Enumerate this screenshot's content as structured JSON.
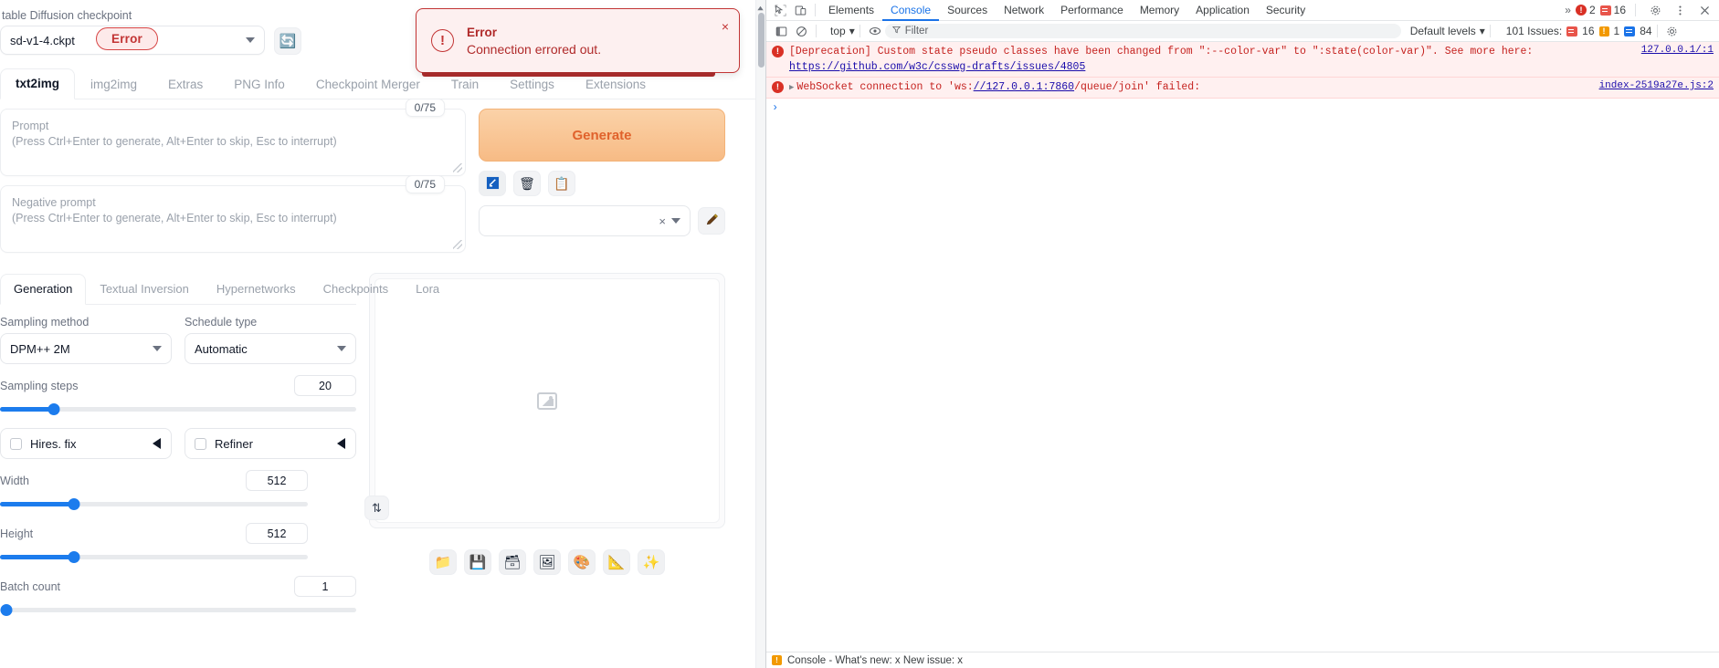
{
  "webui": {
    "checkpoint": {
      "label": "table Diffusion checkpoint",
      "value": "sd-v1-4.ckpt",
      "refresh_icon": "refresh-icon",
      "error_badge": "Error"
    },
    "top_tabs": [
      {
        "label": "txt2img",
        "active": true
      },
      {
        "label": "img2img",
        "active": false
      },
      {
        "label": "Extras",
        "active": false
      },
      {
        "label": "PNG Info",
        "active": false
      },
      {
        "label": "Checkpoint Merger",
        "active": false
      },
      {
        "label": "Train",
        "active": false
      },
      {
        "label": "Settings",
        "active": false
      },
      {
        "label": "Extensions",
        "active": false
      }
    ],
    "prompt": {
      "title": "Prompt",
      "hint": "(Press Ctrl+Enter to generate, Alt+Enter to skip, Esc to interrupt)",
      "token_count": "0/75",
      "value": ""
    },
    "negative_prompt": {
      "title": "Negative prompt",
      "hint": "(Press Ctrl+Enter to generate, Alt+Enter to skip, Esc to interrupt)",
      "token_count": "0/75",
      "value": ""
    },
    "generate_button": "Generate",
    "action_icons": [
      {
        "name": "arrow-paste-icon",
        "glyph": "↙"
      },
      {
        "name": "trash-icon",
        "glyph": "🗑"
      },
      {
        "name": "clipboard-icon",
        "glyph": "📋"
      }
    ],
    "styles": {
      "value": "",
      "clear_glyph": "×",
      "edit_icon": "pencil-icon"
    },
    "sub_tabs": [
      {
        "label": "Generation",
        "active": true
      },
      {
        "label": "Textual Inversion",
        "active": false
      },
      {
        "label": "Hypernetworks",
        "active": false
      },
      {
        "label": "Checkpoints",
        "active": false
      },
      {
        "label": "Lora",
        "active": false
      }
    ],
    "sampling_method": {
      "label": "Sampling method",
      "value": "DPM++ 2M"
    },
    "schedule_type": {
      "label": "Schedule type",
      "value": "Automatic"
    },
    "sampling_steps": {
      "label": "Sampling steps",
      "value": "20",
      "fill_pct": 15
    },
    "hires_fix": {
      "label": "Hires. fix",
      "checked": false
    },
    "refiner": {
      "label": "Refiner",
      "checked": false
    },
    "width": {
      "label": "Width",
      "value": "512",
      "fill_pct": 24
    },
    "height": {
      "label": "Height",
      "value": "512",
      "fill_pct": 24
    },
    "batch_count": {
      "label": "Batch count",
      "value": "1",
      "fill_pct": 0
    },
    "swap_icon": "swap-dimensions-icon",
    "preview": {
      "placeholder_icon": "image-placeholder-icon",
      "toolbar": [
        {
          "name": "folder-icon",
          "glyph": "📁"
        },
        {
          "name": "save-floppy-icon",
          "glyph": "💾"
        },
        {
          "name": "zip-archive-icon",
          "glyph": "🗃"
        },
        {
          "name": "send-to-img2img-icon",
          "glyph": "🖼"
        },
        {
          "name": "palette-icon",
          "glyph": "🎨"
        },
        {
          "name": "ruler-icon",
          "glyph": "📐"
        },
        {
          "name": "sparkles-icon",
          "glyph": "✨"
        }
      ]
    }
  },
  "toast": {
    "icon": "error-circle-icon",
    "title": "Error",
    "message": "Connection errored out.",
    "close_glyph": "×"
  },
  "devtools": {
    "left_icons": [
      {
        "name": "inspect-element-icon"
      },
      {
        "name": "device-toolbar-icon"
      }
    ],
    "tabs": [
      {
        "label": "Elements",
        "active": false
      },
      {
        "label": "Console",
        "active": true
      },
      {
        "label": "Sources",
        "active": false
      },
      {
        "label": "Network",
        "active": false
      },
      {
        "label": "Performance",
        "active": false
      },
      {
        "label": "Memory",
        "active": false
      },
      {
        "label": "Application",
        "active": false
      },
      {
        "label": "Security",
        "active": false
      }
    ],
    "more_tabs_glyph": "»",
    "error_count": "2",
    "warning_count": "16",
    "settings_icon": "gear-icon",
    "more_icon": "kebab-menu-icon",
    "close_icon": "close-icon",
    "toolbar2": {
      "sidebar_icon": "console-sidebar-icon",
      "clear_icon": "clear-console-icon",
      "context": "top",
      "eye_icon": "live-expression-icon",
      "filter_placeholder": "Filter",
      "levels": "Default levels",
      "issues_label": "101 Issues:",
      "issues_errors": "16",
      "issues_warnings": "1",
      "issues_info": "84",
      "settings_icon": "console-settings-icon"
    },
    "messages": [
      {
        "level": "error",
        "text": "[Deprecation] Custom state pseudo classes have been changed from \":--color-var\" to \":state(color-var)\". See more here:",
        "link": "https://github.com/w3c/csswg-drafts/issues/4805",
        "source": "127.0.0.1/:1"
      },
      {
        "level": "error",
        "expandable": true,
        "text_pre": "WebSocket connection to 'ws:",
        "text_link": "//127.0.0.1:7860",
        "text_post": "/queue/join' failed:",
        "source": "index-2519a27e.js:2"
      }
    ],
    "prompt_glyph": "›",
    "footer_text": "Console - What's new: x New issue: x"
  }
}
